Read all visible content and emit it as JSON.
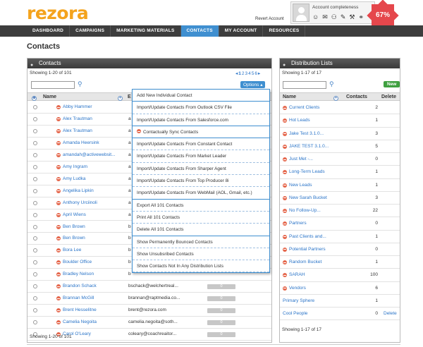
{
  "brand": {
    "logo": "rezora",
    "revert_label": "Revert Account",
    "completeness_label": "Account completeness",
    "completeness_pct": "67%"
  },
  "account_icons": [
    "user-icon",
    "mail-icon",
    "people-icon",
    "pen-icon",
    "tool-icon",
    "link-icon"
  ],
  "nav": [
    {
      "label": "DASHBOARD",
      "active": false
    },
    {
      "label": "CAMPAIGNS",
      "active": false
    },
    {
      "label": "MARKETING MATERIALS",
      "active": false
    },
    {
      "label": "CONTACTS",
      "active": true
    },
    {
      "label": "MY ACCOUNT",
      "active": false
    },
    {
      "label": "RESOURCES",
      "active": false
    }
  ],
  "page_title": "Contacts",
  "contacts": {
    "title": "Contacts",
    "showing_top": "Showing 1-20 of 101",
    "showing_bottom": "Showing 1-20 of 101",
    "pager_prev": "◂",
    "pager_next": "▸",
    "pages": [
      "1",
      "2",
      "3",
      "4",
      "5",
      "6"
    ],
    "options_label": "Options ▴",
    "col_name": "Name",
    "col_email": "E",
    "rows": [
      {
        "name": "Abby Hammer",
        "email": "",
        "minus": true
      },
      {
        "name": "Alex Trautman",
        "email": "a",
        "minus": true
      },
      {
        "name": "Alex Trautman",
        "email": "a",
        "minus": true
      },
      {
        "name": "Amanda Heersink",
        "email": "a",
        "minus": true
      },
      {
        "name": "amandah@activewebsit...",
        "email": "a",
        "minus": true
      },
      {
        "name": "Amy Ingram",
        "email": "a",
        "minus": true
      },
      {
        "name": "Amy Ludka",
        "email": "a",
        "minus": true
      },
      {
        "name": "Angelika Lipkin",
        "email": "a",
        "minus": true
      },
      {
        "name": "Anthony Urciinoli",
        "email": "a",
        "minus": true
      },
      {
        "name": "April Wiens",
        "email": "a",
        "minus": true
      },
      {
        "name": "Ben Brown",
        "email": "b",
        "minus": true
      },
      {
        "name": "Ben Brown",
        "email": "b",
        "minus": true
      },
      {
        "name": "Bora Lee",
        "email": "b",
        "minus": true
      },
      {
        "name": "Boulder Office",
        "email": "b",
        "minus": true
      },
      {
        "name": "Bradley Nelson",
        "email": "b",
        "minus": true
      },
      {
        "name": "Brandon Schack",
        "email": "bschack@welchertreal...",
        "minus": true,
        "bar": "0"
      },
      {
        "name": "Brannan McGill",
        "email": "brannan@raptmedia.co...",
        "minus": true,
        "bar": "0"
      },
      {
        "name": "Brent Hesselitne",
        "email": "brent@rezora.com",
        "minus": true,
        "bar": "0"
      },
      {
        "name": "Camelia Negoita",
        "email": "camelia.negoita@soth...",
        "minus": true,
        "bar": "0"
      },
      {
        "name": "Carol O'Leary",
        "email": "coleary@coachreaitor...",
        "minus": true,
        "bar": "0"
      }
    ]
  },
  "options_menu": [
    {
      "label": "Add New Individual Contact",
      "solid": true
    },
    {
      "label": "Import/Update Contacts From Outlook CSV File",
      "solid": false
    },
    {
      "label": "Import/Update Contacts From Salesforce.com",
      "solid": true
    },
    {
      "label": "Contactually Sync Contacts",
      "solid": true,
      "minus": true
    },
    {
      "label": "Import/Update Contacts From Constant Contact",
      "solid": false
    },
    {
      "label": "Import/Update Contacts From Market Leader",
      "solid": false
    },
    {
      "label": "Import/Update Contacts From Sharper Agent",
      "solid": false
    },
    {
      "label": "Import/Update Contacts From Top Producer 8i",
      "solid": false
    },
    {
      "label": "Import/Update Contacts From WebMail (AOL, Gmail, etc.)",
      "solid": true
    },
    {
      "label": "Export All 101 Contacts",
      "solid": false
    },
    {
      "label": "Print All 101 Contacts",
      "solid": false
    },
    {
      "label": "Delete All 101 Contacts",
      "solid": true
    },
    {
      "label": "Show Permanently Bounced Contacts",
      "solid": false
    },
    {
      "label": "Show Unsubsribed Contacts",
      "solid": false
    },
    {
      "label": "Show Contacts Not In Any Distribution Lists",
      "solid": false
    }
  ],
  "lists": {
    "title": "Distribution Lists",
    "showing_top": "Showing 1-17 of 17",
    "showing_bottom": "Showing 1-17 of 17",
    "new_label": "New",
    "col_name": "Name",
    "col_contacts": "Contacts",
    "col_delete": "Delete",
    "rows": [
      {
        "name": "Current Clients",
        "count": "2",
        "minus": true,
        "delete": ""
      },
      {
        "name": "Hot Leads",
        "count": "1",
        "minus": true,
        "delete": ""
      },
      {
        "name": "Jake Test 3.1.0...",
        "count": "3",
        "minus": true,
        "delete": ""
      },
      {
        "name": "JAKE TEST 3.1.0...",
        "count": "5",
        "minus": true,
        "delete": ""
      },
      {
        "name": "Just Met -...",
        "count": "0",
        "minus": true,
        "delete": ""
      },
      {
        "name": "Long-Term Leads",
        "count": "1",
        "minus": true,
        "delete": ""
      },
      {
        "name": "New Leads",
        "count": "1",
        "minus": true,
        "delete": ""
      },
      {
        "name": "New Sarah Bucket",
        "count": "3",
        "minus": true,
        "delete": ""
      },
      {
        "name": "No Follow-Up...",
        "count": "22",
        "minus": true,
        "delete": ""
      },
      {
        "name": "Partners",
        "count": "0",
        "minus": true,
        "delete": ""
      },
      {
        "name": "Past Clients and...",
        "count": "1",
        "minus": true,
        "delete": ""
      },
      {
        "name": "Potential Partners",
        "count": "0",
        "minus": true,
        "delete": ""
      },
      {
        "name": "Random Bucket",
        "count": "1",
        "minus": true,
        "delete": ""
      },
      {
        "name": "SARAH",
        "count": "100",
        "minus": true,
        "delete": ""
      },
      {
        "name": "Vendors",
        "count": "6",
        "minus": true,
        "delete": ""
      },
      {
        "name": "Primary Sphere",
        "count": "1",
        "minus": false,
        "delete": ""
      },
      {
        "name": "Cool People",
        "count": "0",
        "minus": false,
        "delete": "Delete"
      }
    ]
  },
  "colors": {
    "accent": "#3f8fd0",
    "brand": "#f4a31d",
    "badge": "#e5474c",
    "new_button": "#3fa040"
  }
}
